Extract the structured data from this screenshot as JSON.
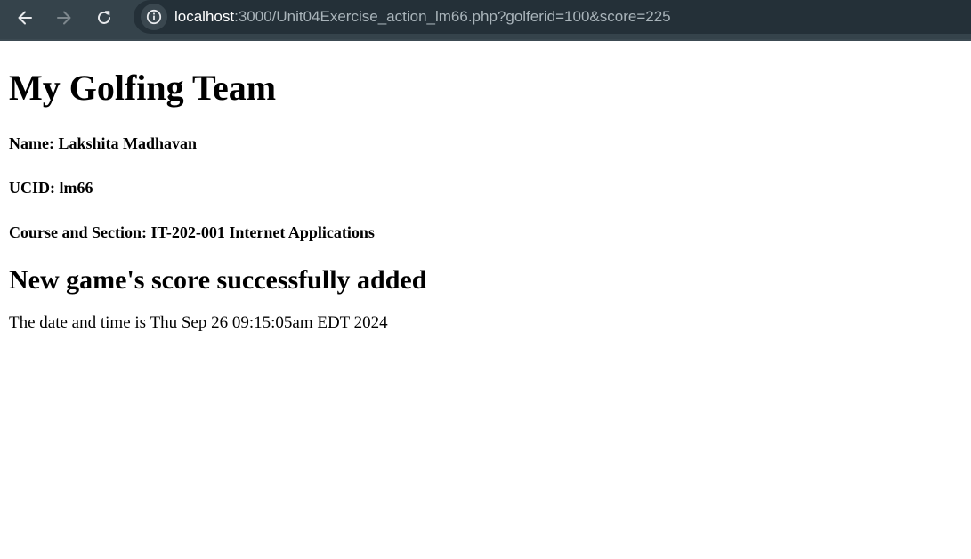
{
  "browser": {
    "url_host": "localhost",
    "url_path": ":3000/Unit04Exercise_action_lm66.php?golferid=100&score=225"
  },
  "page": {
    "heading": "My Golfing Team",
    "name_line": "Name: Lakshita Madhavan",
    "ucid_line": "UCID: lm66",
    "course_line": "Course and Section: IT-202-001 Internet Applications",
    "status_heading": "New game's score successfully added",
    "datetime_line": "The date and time is Thu Sep 26 09:15:05am EDT 2024"
  },
  "colors": {
    "toolbar_bg": "#35434b",
    "omnibox_bg": "#243038",
    "url_host": "#ffffff",
    "url_path": "#a9b4ba"
  },
  "icons": {
    "back": "arrow-left-icon",
    "forward": "arrow-right-icon",
    "reload": "reload-icon",
    "site_info": "info-icon"
  }
}
